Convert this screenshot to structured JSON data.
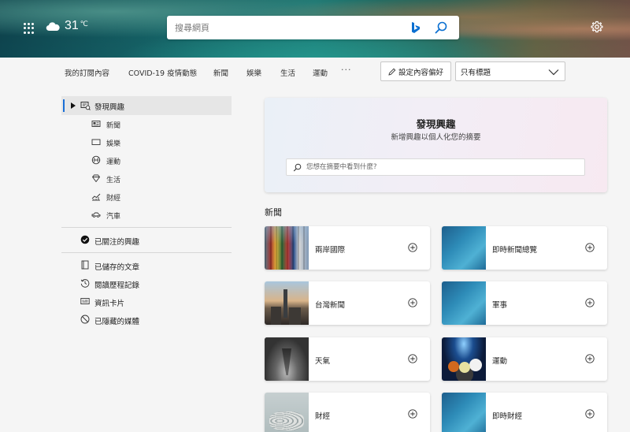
{
  "header": {
    "weather": {
      "temperature": "31",
      "unit": "℃"
    },
    "search": {
      "placeholder": "搜尋網頁"
    }
  },
  "nav": {
    "tabs": [
      "我的訂閱內容",
      "COVID-19 疫情動態",
      "新聞",
      "娛樂",
      "生活",
      "運動"
    ],
    "more": "···",
    "preferences_button": "設定內容偏好",
    "view_select": "只有標題"
  },
  "sidebar": {
    "active": "發現興趣",
    "subitems": [
      "新聞",
      "娛樂",
      "運動",
      "生活",
      "財經",
      "汽車"
    ],
    "followed": "已關注的興趣",
    "saved": "已儲存的文章",
    "history": "閱讀歷程記錄",
    "cards": "資訊卡片",
    "hidden": "已隱藏的媒體"
  },
  "hero": {
    "title": "發現興趣",
    "subtitle": "新增興趣以個人化您的摘要",
    "search_placeholder": "您想在摘要中看到什麼?"
  },
  "section": {
    "title": "新聞"
  },
  "topics": [
    "兩岸國際",
    "即時新聞總覽",
    "台灣新聞",
    "軍事",
    "天氣",
    "運動",
    "財經",
    "即時財經"
  ],
  "colors": {
    "accent": "#1a6fd6",
    "bing_blue": "#0a6fd1"
  }
}
